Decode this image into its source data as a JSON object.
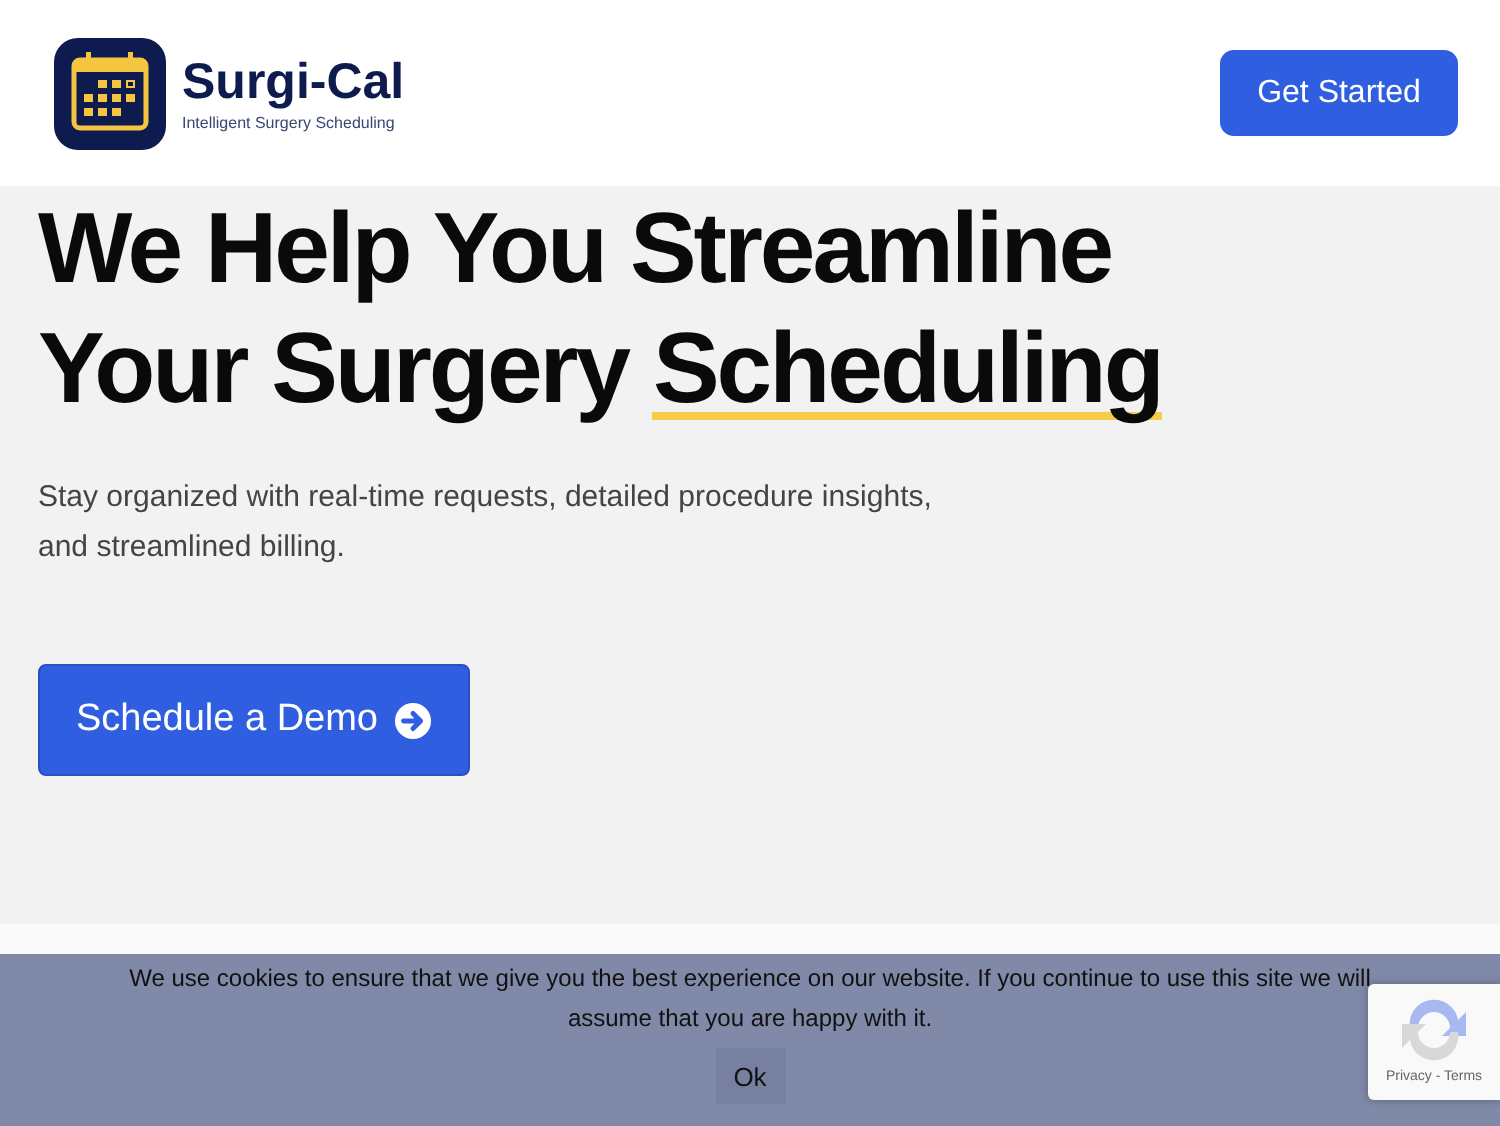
{
  "header": {
    "brand": "Surgi-Cal",
    "tagline": "Intelligent Surgery Scheduling",
    "cta": "Get Started"
  },
  "hero": {
    "headline": "We Help You Streamline Your Surgery",
    "headline_highlight": "Scheduling",
    "subtitle": "Stay organized with real-time requests, detailed procedure insights, and streamlined billing.",
    "button": "Schedule a Demo"
  },
  "cookie_bar": {
    "message": "We use cookies to ensure that we give you the best experience on our website. If you continue to use this site we will assume that you are happy with it.",
    "button": "Ok"
  },
  "recaptcha": {
    "links": "Privacy - Terms"
  }
}
